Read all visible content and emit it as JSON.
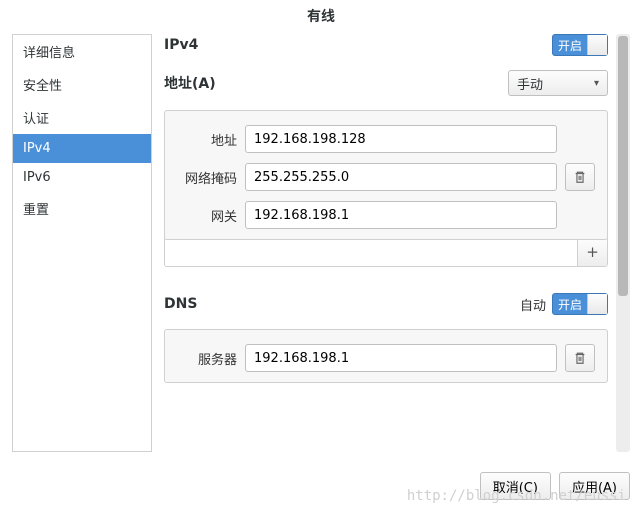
{
  "title": "有线",
  "sidebar": {
    "items": [
      {
        "label": "详细信息"
      },
      {
        "label": "安全性"
      },
      {
        "label": "认证"
      },
      {
        "label": "IPv4"
      },
      {
        "label": "IPv6"
      },
      {
        "label": "重置"
      }
    ],
    "active_index": 3
  },
  "ipv4": {
    "heading": "IPv4",
    "toggle_label": "开启",
    "address_heading": "地址(A)",
    "method": "手动",
    "rows": {
      "address_label": "地址",
      "address_value": "192.168.198.128",
      "netmask_label": "网络掩码",
      "netmask_value": "255.255.255.0",
      "gateway_label": "网关",
      "gateway_value": "192.168.198.1"
    },
    "add_label": "+"
  },
  "dns": {
    "heading": "DNS",
    "auto_label": "自动",
    "toggle_label": "开启",
    "server_label": "服务器",
    "server_value": "192.168.198.1"
  },
  "footer": {
    "cancel": "取消(C)",
    "apply": "应用(A)"
  },
  "watermark": "http://blog.csdn.net/eussi"
}
